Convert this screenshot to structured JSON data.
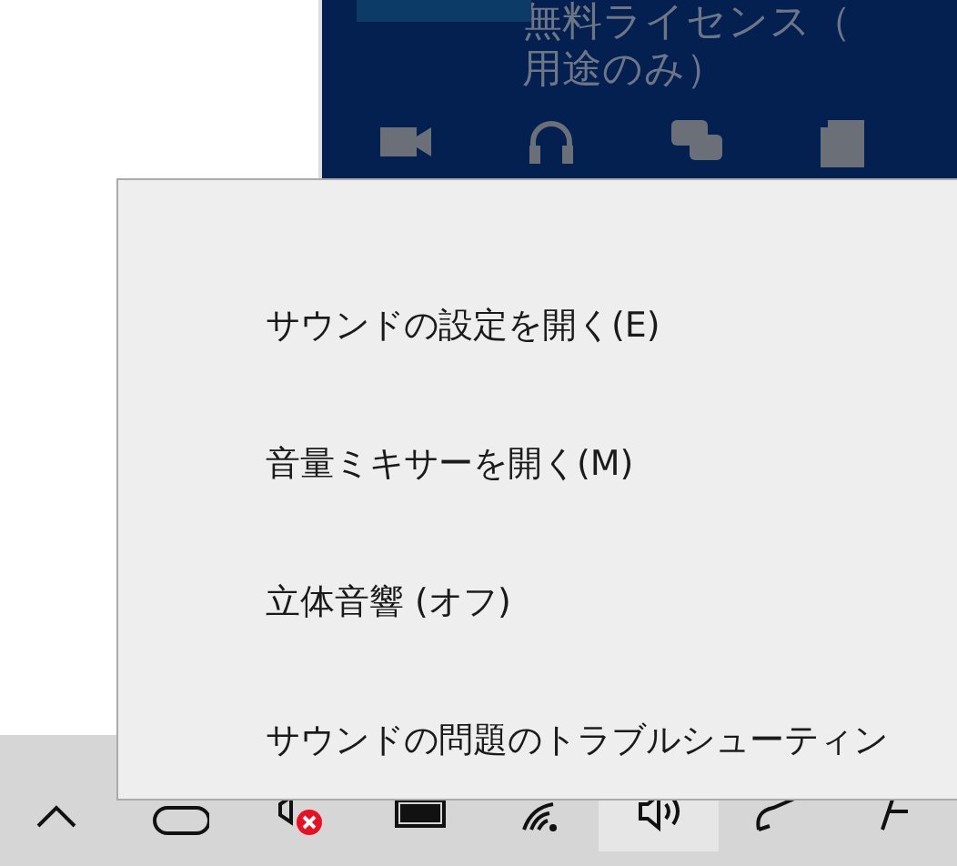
{
  "account_panel": {
    "license_lines": [
      "無料ライセンス（",
      "用途のみ）"
    ]
  },
  "context_menu": {
    "items": [
      {
        "label": "サウンドの設定を開く(E)"
      },
      {
        "label": "音量ミキサーを開く(M)"
      },
      {
        "label": "立体音響 (オフ)"
      },
      {
        "label": "サウンドの問題のトラブルシューティン"
      }
    ]
  },
  "taskbar": {
    "tray_icons": [
      {
        "kind": "chevron",
        "selected": false
      },
      {
        "kind": "pill",
        "selected": false
      },
      {
        "kind": "speaker-error",
        "selected": false
      },
      {
        "kind": "battery",
        "selected": false
      },
      {
        "kind": "wifi",
        "selected": false
      },
      {
        "kind": "speaker",
        "selected": true
      },
      {
        "kind": "pen",
        "selected": false
      },
      {
        "kind": "ime",
        "selected": false
      }
    ]
  }
}
